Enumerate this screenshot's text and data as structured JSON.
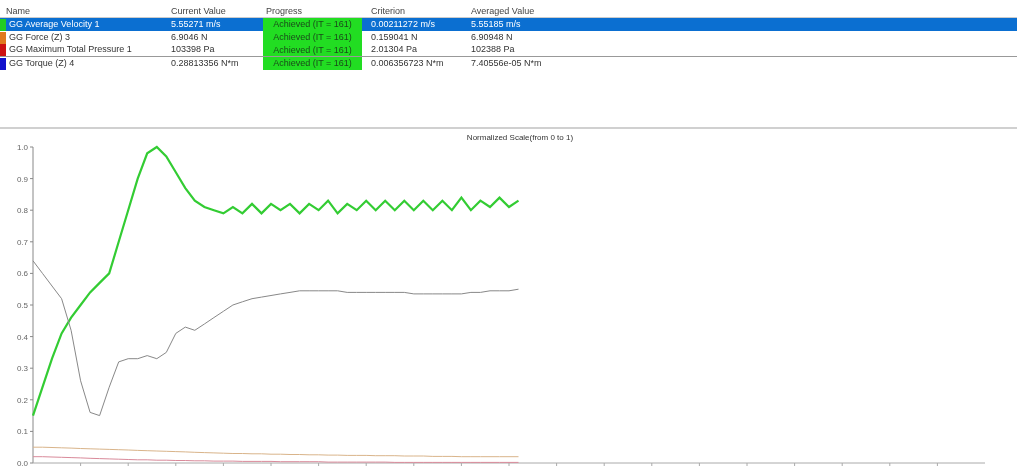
{
  "table": {
    "columns": [
      "Name",
      "Current Value",
      "Progress",
      "Criterion",
      "Averaged Value"
    ],
    "rows": [
      {
        "name": "GG Average Velocity 1",
        "color": "#22cc22",
        "selected": true,
        "current_value": "5.55271 m/s",
        "progress": "Achieved (IT = 161)",
        "criterion": "0.00211272 m/s",
        "averaged_value": "5.55185 m/s"
      },
      {
        "name": "GG Force (Z) 3",
        "color": "#e07a1f",
        "selected": false,
        "current_value": "6.9046 N",
        "progress": "Achieved (IT = 161)",
        "criterion": "0.159041 N",
        "averaged_value": "6.90948 N"
      },
      {
        "name": "GG Maximum Total Pressure 1",
        "color": "#cc1111",
        "selected": false,
        "current_value": "103398 Pa",
        "progress": "Achieved (IT = 161)",
        "criterion": "2.01304 Pa",
        "averaged_value": "102388 Pa"
      },
      {
        "name": "GG Torque (Z) 4",
        "color": "#1111cc",
        "selected": false,
        "current_value": "0.28813356 N*m",
        "progress": "Achieved (IT = 161)",
        "criterion": "0.006356723 N*m",
        "averaged_value": "7.40556e-05 N*m"
      }
    ]
  },
  "chart": {
    "chart_data": {
      "type": "line",
      "title": "Normalized Scale(from 0 to 1)",
      "ylim": [
        0,
        1
      ],
      "yticks": [
        {
          "value": 0,
          "label": "0.0"
        },
        {
          "value": 0.1,
          "label": "0.1"
        },
        {
          "value": 0.2,
          "label": "0.2"
        },
        {
          "value": 0.3,
          "label": "0.3"
        },
        {
          "value": 0.4,
          "label": "0.4"
        },
        {
          "value": 0.5,
          "label": "0.5"
        },
        {
          "value": 0.6,
          "label": "0.6"
        },
        {
          "value": 0.7,
          "label": "0.7"
        },
        {
          "value": 0.8,
          "label": "0.8"
        },
        {
          "value": 0.9,
          "label": "0.9"
        },
        {
          "value": 1,
          "label": "1.0"
        }
      ],
      "categories": [
        null,
        null,
        null,
        null,
        null,
        null,
        null,
        null,
        null,
        null,
        null,
        null,
        null,
        null,
        null,
        null,
        null,
        null,
        null,
        null,
        null,
        null,
        null,
        null,
        null,
        null,
        null,
        null,
        null,
        null,
        null,
        null,
        null,
        null,
        null,
        null,
        null,
        null,
        null,
        null,
        null,
        null,
        null,
        null,
        null,
        null,
        null,
        null,
        null,
        null,
        null,
        null
      ],
      "series": [
        {
          "color": "#33cc33",
          "values": [
            0.15,
            0.24,
            0.33,
            0.41,
            0.46,
            0.5,
            0.54,
            0.57,
            0.6,
            0.7,
            0.8,
            0.9,
            0.98,
            1.0,
            0.97,
            0.92,
            0.87,
            0.83,
            0.81,
            0.8,
            0.79,
            0.81,
            0.79,
            0.82,
            0.79,
            0.82,
            0.8,
            0.82,
            0.79,
            0.82,
            0.8,
            0.83,
            0.79,
            0.82,
            0.8,
            0.83,
            0.8,
            0.83,
            0.8,
            0.83,
            0.8,
            0.83,
            0.8,
            0.83,
            0.8,
            0.84,
            0.8,
            0.83,
            0.81,
            0.84,
            0.81,
            0.83
          ]
        },
        {
          "color": "#888888",
          "values": [
            0.64,
            0.6,
            0.56,
            0.52,
            0.42,
            0.26,
            0.16,
            0.15,
            0.24,
            0.32,
            0.33,
            0.33,
            0.34,
            0.33,
            0.35,
            0.41,
            0.43,
            0.42,
            0.44,
            0.46,
            0.48,
            0.5,
            0.51,
            0.52,
            0.525,
            0.53,
            0.535,
            0.54,
            0.545,
            0.545,
            0.545,
            0.545,
            0.545,
            0.54,
            0.54,
            0.54,
            0.54,
            0.54,
            0.54,
            0.54,
            0.535,
            0.535,
            0.535,
            0.535,
            0.535,
            0.535,
            0.54,
            0.54,
            0.545,
            0.545,
            0.545,
            0.55
          ]
        },
        {
          "color": "#d9b48a",
          "values": [
            0.05,
            0.05,
            0.049,
            0.048,
            0.047,
            0.046,
            0.045,
            0.044,
            0.043,
            0.042,
            0.041,
            0.04,
            0.039,
            0.038,
            0.037,
            0.036,
            0.035,
            0.034,
            0.033,
            0.032,
            0.031,
            0.03,
            0.03,
            0.029,
            0.029,
            0.028,
            0.028,
            0.027,
            0.027,
            0.026,
            0.026,
            0.025,
            0.025,
            0.024,
            0.024,
            0.024,
            0.023,
            0.023,
            0.023,
            0.022,
            0.022,
            0.022,
            0.021,
            0.021,
            0.021,
            0.02,
            0.02,
            0.02,
            0.02,
            0.02,
            0.02,
            0.02
          ]
        },
        {
          "color": "#d98a9a",
          "values": [
            0.02,
            0.02,
            0.019,
            0.018,
            0.017,
            0.016,
            0.015,
            0.014,
            0.013,
            0.012,
            0.011,
            0.01,
            0.01,
            0.009,
            0.009,
            0.008,
            0.008,
            0.007,
            0.007,
            0.006,
            0.006,
            0.006,
            0.005,
            0.005,
            0.005,
            0.005,
            0.004,
            0.004,
            0.004,
            0.004,
            0.004,
            0.003,
            0.003,
            0.003,
            0.003,
            0.003,
            0.003,
            0.003,
            0.002,
            0.002,
            0.002,
            0.002,
            0.002,
            0.002,
            0.002,
            0.002,
            0.002,
            0.002,
            0.002,
            0.002,
            0.002,
            0.002
          ]
        }
      ]
    }
  }
}
